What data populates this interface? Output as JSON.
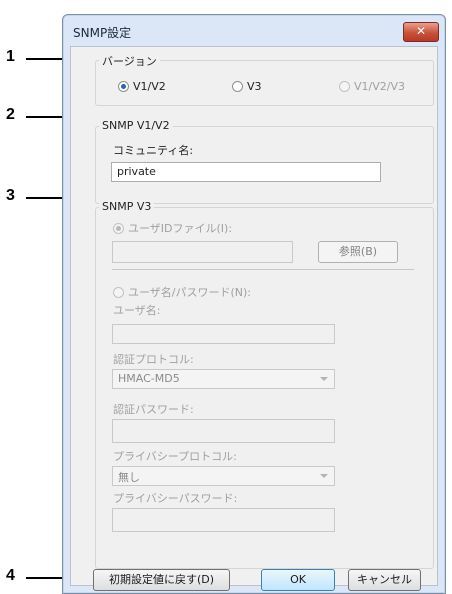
{
  "callouts": [
    "1",
    "2",
    "3",
    "4"
  ],
  "window": {
    "title": "SNMP設定",
    "close_glyph": "✕"
  },
  "version": {
    "legend": "バージョン",
    "options": [
      {
        "label": "V1/V2",
        "selected": true,
        "enabled": true
      },
      {
        "label": "V3",
        "selected": false,
        "enabled": true
      },
      {
        "label": "V1/V2/V3",
        "selected": false,
        "enabled": false
      }
    ]
  },
  "snmp_v1v2": {
    "legend": "SNMP V1/V2",
    "community_label": "コミュニティ名:",
    "community_value": "private"
  },
  "snmp_v3": {
    "legend": "SNMP V3",
    "userid_file_radio": "ユーザIDファイル(I):",
    "userid_file_value": "",
    "browse_button": "参照(B)",
    "username_password_radio": "ユーザ名/パスワード(N):",
    "username_label": "ユーザ名:",
    "username_value": "",
    "auth_protocol_label": "認証プロトコル:",
    "auth_protocol_value": "HMAC-MD5",
    "auth_password_label": "認証パスワード:",
    "auth_password_value": "",
    "privacy_protocol_label": "プライバシープロトコル:",
    "privacy_protocol_value": "無し",
    "privacy_password_label": "プライバシーパスワード:",
    "privacy_password_value": ""
  },
  "buttons": {
    "reset": "初期設定値に戻す(D)",
    "ok": "OK",
    "cancel": "キャンセル"
  },
  "colors": {
    "window_frame": "#dbe7f6",
    "client_bg": "#f0f0f0",
    "close_button": "#c9513a",
    "radio_selected": "#2c62b4"
  }
}
